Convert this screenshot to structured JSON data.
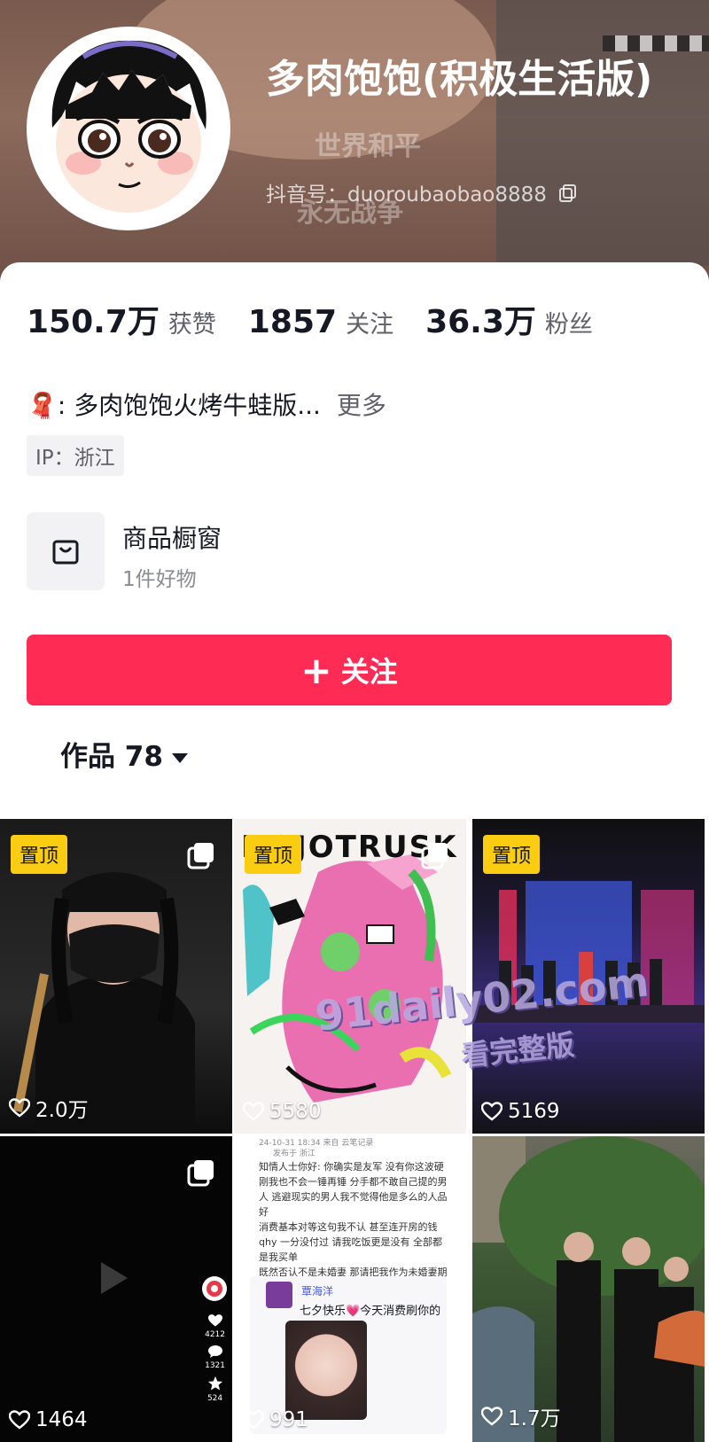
{
  "profile": {
    "name": "多肉饱饱(积极生活版)",
    "douyin_id": "抖音号：duoroubaobao8888",
    "banner_text": [
      "世界和平",
      "永无战争"
    ]
  },
  "stats": [
    {
      "value": "150.7万",
      "label": "获赞"
    },
    {
      "value": "1857",
      "label": "关注"
    },
    {
      "value": "36.3万",
      "label": "粉丝"
    }
  ],
  "bio": {
    "emoji": "🧣",
    "text": ": 多肉饱饱火烤牛蛙版...",
    "more": "更多"
  },
  "ip_tag": "IP：浙江",
  "shop": {
    "title": "商品橱窗",
    "subtitle": "1件好物"
  },
  "follow_button": {
    "plus": "+",
    "label": "关注"
  },
  "works_tab": {
    "label": "作品 78"
  },
  "grid": [
    {
      "pinned_label": "置顶",
      "likes": "2.0万",
      "multi": true
    },
    {
      "pinned_label": "置顶",
      "likes": "5580",
      "multi": true
    },
    {
      "pinned_label": "置顶",
      "likes": "5169",
      "multi": false
    },
    {
      "pinned_label": "",
      "likes": "1464",
      "multi": true
    },
    {
      "pinned_label": "",
      "likes": "991",
      "multi": false
    },
    {
      "pinned_label": "",
      "likes": "1.7万",
      "multi": false
    }
  ],
  "cell2_art_text": "DOJOTRUSK",
  "cell4_side_counts": [
    "4212",
    "1321",
    "524"
  ],
  "cell5": {
    "header": "24-10-31 18:34 来自 云笔记录",
    "header_loc": "发布于 浙江",
    "paragraphs": [
      "知情人士你好: 你确实是友军 没有你这波硬刚我也不会一锤再锤 分手都不敢自己提的男人 逃避现实的男人我不觉得他是多么的人品好",
      "消费基本对等这句我不认 甚至连开房的钱 qhy 一分没付过 请我吃饭更是没有 全部都是我买单",
      "既然否认不是未婚妻 那请把我作为未婚妻期间买的昂贵的手表 衣物以及各种消费归还 稍后我把账单整理出来 覃先生也确实每次都在刷我的卡"
    ],
    "chat_name": "覃海洋",
    "chat_msg": "七夕快乐💗今天消费刷你的卡💡"
  },
  "watermark": {
    "line1": "91daily02.com",
    "line2": "看完整版"
  },
  "colors": {
    "accent": "#fe2c55",
    "pin": "#facd13"
  }
}
